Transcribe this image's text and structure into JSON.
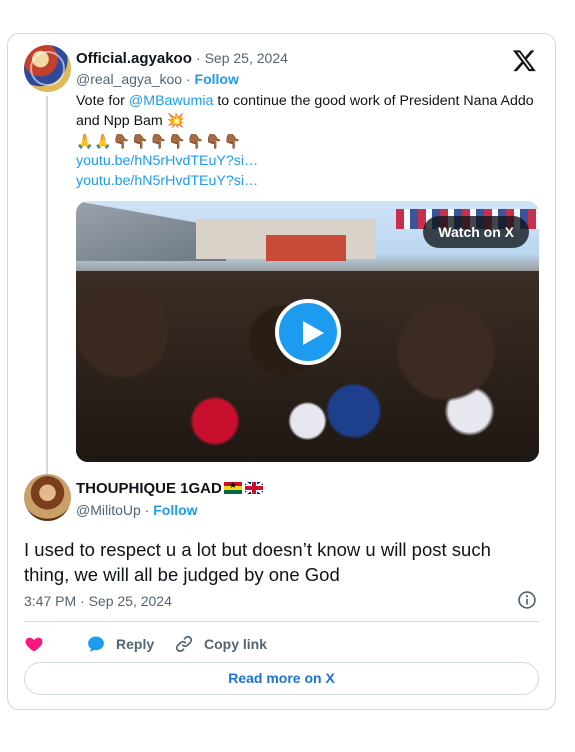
{
  "parent": {
    "name": "Official.agyakoo",
    "date": "· Sep 25, 2024",
    "handle": "@real_agya_koo",
    "follow": "Follow",
    "text_prefix": "Vote for ",
    "mention": "@MBawumia",
    "text_suffix": " to continue the good work of President Nana Addo and Npp Bam 💥",
    "emojis": "🙏🙏👇🏾👇🏾👇🏾👇🏾👇🏾👇🏾👇🏾",
    "links": [
      "youtu.be/hN5rHvdTEuY?si…",
      "youtu.be/hN5rHvdTEuY?si…"
    ],
    "media": {
      "watch_label": "Watch on X"
    }
  },
  "reply": {
    "name": "THOUPHIQUE 1GAD",
    "handle": "@MilitoUp",
    "follow": "Follow",
    "text": "I used to respect u a lot but doesn’t know u will post such thing, we will all be judged by one God",
    "time": "3:47 PM · Sep 25, 2024"
  },
  "actions": {
    "reply": "Reply",
    "copy_link": "Copy link"
  },
  "read_more": "Read more on X",
  "icons": [
    "x-logo-icon",
    "play-icon",
    "info-icon",
    "heart-icon",
    "reply-icon",
    "link-icon"
  ],
  "colors": {
    "accent": "#1d9bf0",
    "heart": "#f91880",
    "text": "#0f1419",
    "muted": "#536471",
    "border": "#cfd9de"
  }
}
